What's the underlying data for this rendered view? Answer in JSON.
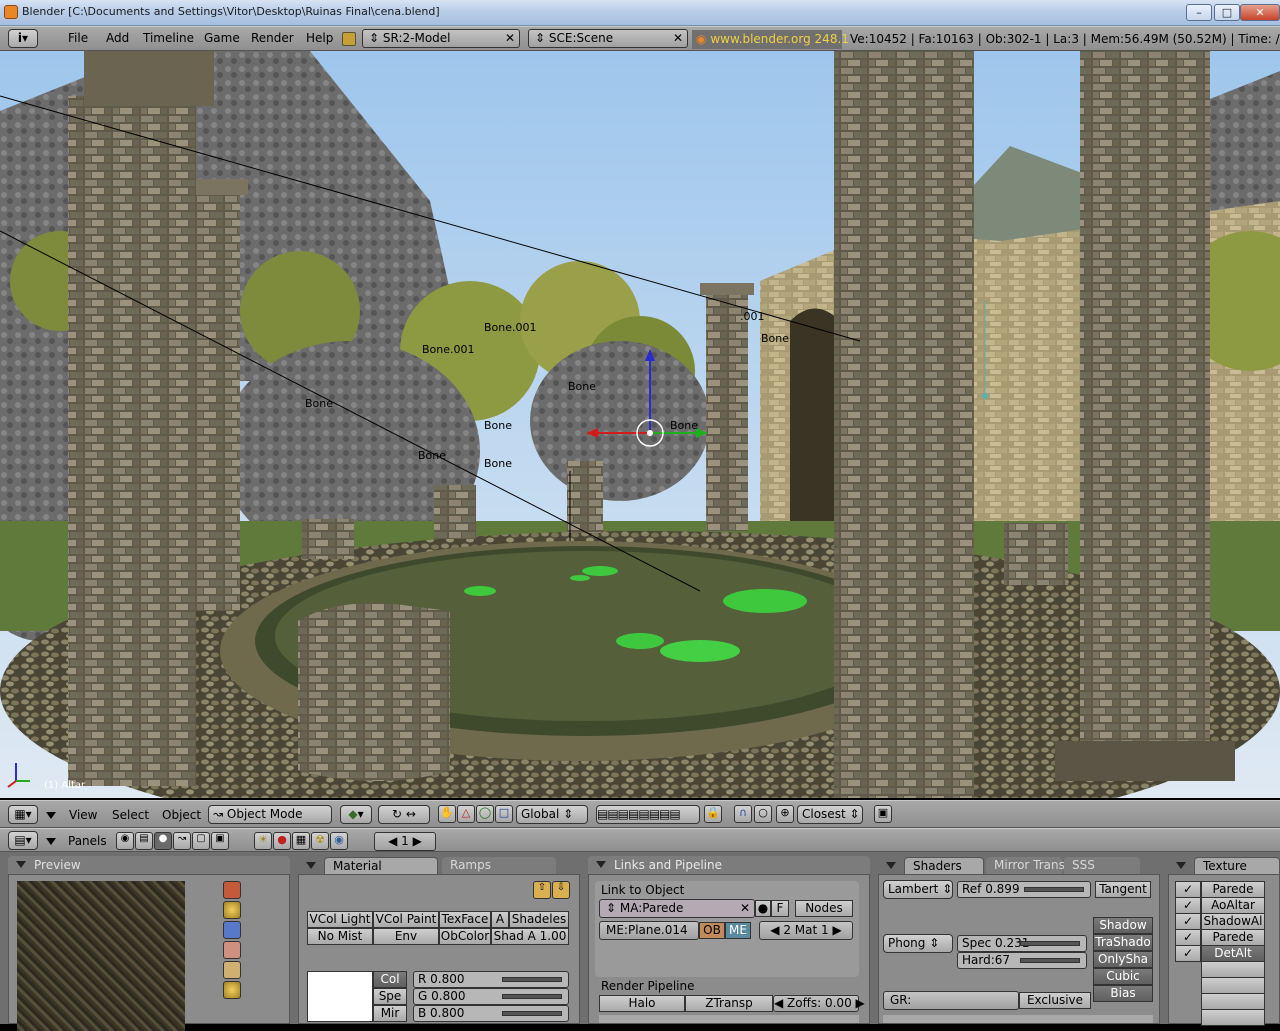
{
  "window": {
    "title": "Blender [C:\\Documents and Settings\\Vitor\\Desktop\\Ruinas Final\\cena.blend]"
  },
  "top_header": {
    "menus": [
      "File",
      "Add",
      "Timeline",
      "Game",
      "Render",
      "Help"
    ],
    "screen": "SR:2-Model",
    "scene": "SCE:Scene",
    "url": "www.blender.org 248.1",
    "stats": "Ve:10452 | Fa:10163 | Ob:302-1 | La:3  | Mem:56.49M (50.52M)  | Time: /"
  },
  "viewport": {
    "object_label": "(1) Altar",
    "bone_labels": [
      "Bone.001",
      "Bone.001",
      "Bone",
      "Bone",
      "Bone",
      "Bone",
      "Bone",
      "Bone",
      ".001",
      "Bone"
    ]
  },
  "view3d_header": {
    "menus": [
      "View",
      "Select",
      "Object"
    ],
    "mode": "Object Mode",
    "orientation": "Global",
    "snap": "Closest"
  },
  "buttons_header": {
    "label": "Panels",
    "frame": "1"
  },
  "preview_panel": {
    "title": "Preview"
  },
  "material_panel": {
    "tabs": [
      "Material",
      "Ramps"
    ],
    "row1": [
      "VCol Light",
      "VCol Paint",
      "TexFace",
      "A",
      "Shadeles"
    ],
    "row2": [
      "No Mist",
      "Env",
      "ObColor",
      "Shad A 1.00"
    ],
    "color_buttons": [
      "Col",
      "Spe",
      "Mir"
    ],
    "rgb": [
      "R 0.800",
      "G 0.800",
      "B 0.800"
    ]
  },
  "links_panel": {
    "title": "Links and Pipeline",
    "link_to_object": "Link to Object",
    "material": "MA:Parede",
    "f_btn": "F",
    "nodes": "Nodes",
    "mesh": "ME:Plane.014",
    "ob": "OB",
    "me": "ME",
    "mat_count": "2 Mat 1",
    "render_pipeline": "Render Pipeline",
    "halo": "Halo",
    "ztransp": "ZTransp",
    "zoffs": "Zoffs: 0.00"
  },
  "shaders_panel": {
    "tabs": [
      "Shaders",
      "Mirror Trans",
      "SSS"
    ],
    "diffuse": "Lambert",
    "ref": "Ref  0.899",
    "tangent": "Tangent",
    "specular": "Phong",
    "spec": "Spec 0.231",
    "hard": "Hard:67",
    "toggles": [
      "Shadow",
      "TraShado",
      "OnlySha",
      "Cubic",
      "Bias"
    ],
    "gr": "GR:",
    "exclusive": "Exclusive"
  },
  "texture_panel": {
    "title": "Texture",
    "channels": [
      "Parede",
      "AoAltar",
      "ShadowAl",
      "Parede",
      "DetAlt"
    ]
  }
}
